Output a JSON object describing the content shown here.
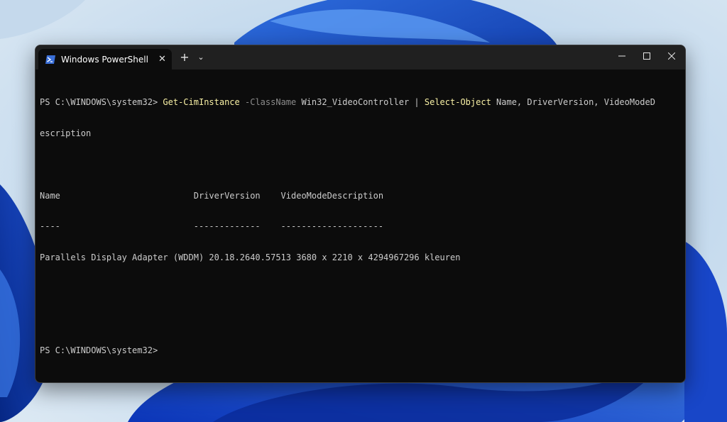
{
  "window": {
    "tab_title": "Windows PowerShell",
    "tab_close": "✕",
    "new_tab": "+",
    "dropdown": "⌄"
  },
  "console": {
    "prompt1": "PS C:\\WINDOWS\\system32> ",
    "cmd1": "Get-CimInstance",
    "param1": " -ClassName",
    "arg1": " Win32_VideoController ",
    "pipe": "| ",
    "cmd2": "Select-Object",
    "args2": " Name, DriverVersion, VideoModeD",
    "wrap": "escription",
    "header": "Name                          DriverVersion    VideoModeDescription",
    "underline": "----                          -------------    --------------------",
    "row": "Parallels Display Adapter (WDDM) 20.18.2640.57513 3680 x 2210 x 4294967296 kleuren",
    "prompt2": "PS C:\\WINDOWS\\system32>"
  },
  "colors": {
    "terminal_bg": "#0c0c0c",
    "titlebar_bg": "#202020",
    "cmdlet": "#f9f1a5",
    "parameter": "#8b8b8b",
    "text": "#cccccc"
  }
}
